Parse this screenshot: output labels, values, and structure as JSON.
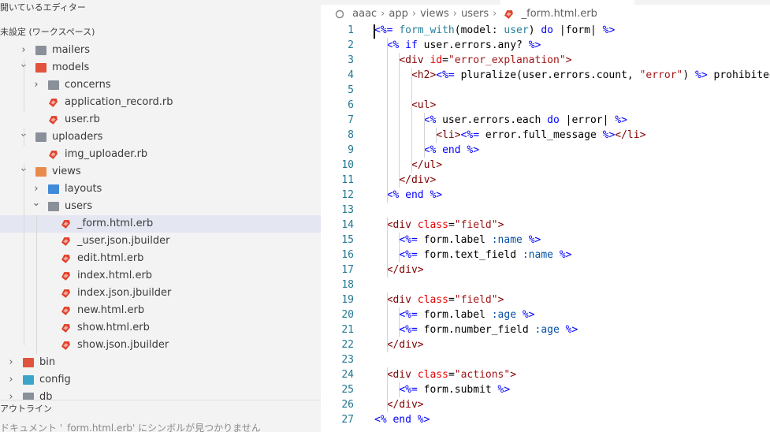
{
  "sidebar": {
    "open_editors_header": "開いているエディター",
    "workspace_header": "未設定 (ワークスペース)",
    "tree": [
      {
        "label": "mailers",
        "kind": "folder",
        "expanded": false,
        "depth": 1
      },
      {
        "label": "models",
        "kind": "folder-red",
        "expanded": true,
        "depth": 1
      },
      {
        "label": "concerns",
        "kind": "folder",
        "expanded": false,
        "depth": 2
      },
      {
        "label": "application_record.rb",
        "kind": "ruby",
        "depth": 2
      },
      {
        "label": "user.rb",
        "kind": "ruby",
        "depth": 2
      },
      {
        "label": "uploaders",
        "kind": "folder",
        "expanded": true,
        "depth": 1
      },
      {
        "label": "img_uploader.rb",
        "kind": "ruby",
        "depth": 2
      },
      {
        "label": "views",
        "kind": "folder-orange",
        "expanded": true,
        "depth": 1
      },
      {
        "label": "layouts",
        "kind": "folder-blue",
        "expanded": false,
        "depth": 2
      },
      {
        "label": "users",
        "kind": "folder",
        "expanded": true,
        "depth": 2
      },
      {
        "label": "_form.html.erb",
        "kind": "ruby",
        "depth": 3,
        "selected": true
      },
      {
        "label": "_user.json.jbuilder",
        "kind": "ruby",
        "depth": 3
      },
      {
        "label": "edit.html.erb",
        "kind": "ruby",
        "depth": 3
      },
      {
        "label": "index.html.erb",
        "kind": "ruby",
        "depth": 3
      },
      {
        "label": "index.json.jbuilder",
        "kind": "ruby",
        "depth": 3
      },
      {
        "label": "new.html.erb",
        "kind": "ruby",
        "depth": 3
      },
      {
        "label": "show.html.erb",
        "kind": "ruby",
        "depth": 3
      },
      {
        "label": "show.json.jbuilder",
        "kind": "ruby",
        "depth": 3
      },
      {
        "label": "bin",
        "kind": "folder-red",
        "expanded": false,
        "depth": 0
      },
      {
        "label": "config",
        "kind": "folder-cyan",
        "expanded": false,
        "depth": 0
      },
      {
        "label": "db",
        "kind": "folder",
        "expanded": false,
        "depth": 0
      }
    ],
    "outline_header": "アウトライン",
    "outline_message": "ドキュメント '_form.html.erb' にシンボルが見つかりません"
  },
  "editor": {
    "breadcrumb": [
      "aaac",
      "app",
      "views",
      "users",
      "_form.html.erb"
    ],
    "lines": [
      {
        "n": "1",
        "tokens": [
          [
            "erb",
            "<%="
          ],
          [
            "txt",
            " "
          ],
          [
            "rb",
            "form_with"
          ],
          [
            "txt",
            "(model: "
          ],
          [
            "rb",
            "user"
          ],
          [
            "txt",
            ") "
          ],
          [
            "kw",
            "do"
          ],
          [
            "txt",
            " |form| "
          ],
          [
            "erb",
            "%>"
          ]
        ]
      },
      {
        "n": "2",
        "tokens": [
          [
            "txt",
            "  "
          ],
          [
            "erb",
            "<%"
          ],
          [
            "txt",
            " "
          ],
          [
            "kw",
            "if"
          ],
          [
            "txt",
            " user.errors.any? "
          ],
          [
            "erb",
            "%>"
          ]
        ]
      },
      {
        "n": "3",
        "tokens": [
          [
            "txt",
            "    "
          ],
          [
            "tag",
            "<div"
          ],
          [
            "txt",
            " "
          ],
          [
            "attr",
            "id"
          ],
          [
            "txt",
            "="
          ],
          [
            "str",
            "\"error_explanation\""
          ],
          [
            "tag",
            ">"
          ]
        ]
      },
      {
        "n": "4",
        "tokens": [
          [
            "txt",
            "      "
          ],
          [
            "tag",
            "<h2>"
          ],
          [
            "erb",
            "<%="
          ],
          [
            "txt",
            " pluralize(user.errors.count, "
          ],
          [
            "str",
            "\"error\""
          ],
          [
            "txt",
            ") "
          ],
          [
            "erb",
            "%>"
          ],
          [
            "txt",
            " prohibited"
          ]
        ]
      },
      {
        "n": "5",
        "tokens": []
      },
      {
        "n": "6",
        "tokens": [
          [
            "txt",
            "      "
          ],
          [
            "tag",
            "<ul>"
          ]
        ]
      },
      {
        "n": "7",
        "tokens": [
          [
            "txt",
            "        "
          ],
          [
            "erb",
            "<%"
          ],
          [
            "txt",
            " user.errors.each "
          ],
          [
            "kw",
            "do"
          ],
          [
            "txt",
            " |error| "
          ],
          [
            "erb",
            "%>"
          ]
        ]
      },
      {
        "n": "8",
        "tokens": [
          [
            "txt",
            "          "
          ],
          [
            "tag",
            "<li>"
          ],
          [
            "erb",
            "<%="
          ],
          [
            "txt",
            " error.full_message "
          ],
          [
            "erb",
            "%>"
          ],
          [
            "tag",
            "</li>"
          ]
        ]
      },
      {
        "n": "9",
        "tokens": [
          [
            "txt",
            "        "
          ],
          [
            "erb",
            "<%"
          ],
          [
            "txt",
            " "
          ],
          [
            "kw",
            "end"
          ],
          [
            "txt",
            " "
          ],
          [
            "erb",
            "%>"
          ]
        ]
      },
      {
        "n": "10",
        "tokens": [
          [
            "txt",
            "      "
          ],
          [
            "tag",
            "</ul>"
          ]
        ]
      },
      {
        "n": "11",
        "tokens": [
          [
            "txt",
            "    "
          ],
          [
            "tag",
            "</div>"
          ]
        ]
      },
      {
        "n": "12",
        "tokens": [
          [
            "txt",
            "  "
          ],
          [
            "erb",
            "<%"
          ],
          [
            "txt",
            " "
          ],
          [
            "kw",
            "end"
          ],
          [
            "txt",
            " "
          ],
          [
            "erb",
            "%>"
          ]
        ]
      },
      {
        "n": "13",
        "tokens": []
      },
      {
        "n": "14",
        "tokens": [
          [
            "txt",
            "  "
          ],
          [
            "tag",
            "<div"
          ],
          [
            "txt",
            " "
          ],
          [
            "attr",
            "class"
          ],
          [
            "txt",
            "="
          ],
          [
            "str",
            "\"field\""
          ],
          [
            "tag",
            ">"
          ]
        ]
      },
      {
        "n": "15",
        "tokens": [
          [
            "txt",
            "    "
          ],
          [
            "erb",
            "<%="
          ],
          [
            "txt",
            " form.label "
          ],
          [
            "sym",
            ":name"
          ],
          [
            "txt",
            " "
          ],
          [
            "erb",
            "%>"
          ]
        ]
      },
      {
        "n": "16",
        "tokens": [
          [
            "txt",
            "    "
          ],
          [
            "erb",
            "<%="
          ],
          [
            "txt",
            " form.text_field "
          ],
          [
            "sym",
            ":name"
          ],
          [
            "txt",
            " "
          ],
          [
            "erb",
            "%>"
          ]
        ]
      },
      {
        "n": "17",
        "tokens": [
          [
            "txt",
            "  "
          ],
          [
            "tag",
            "</div>"
          ]
        ]
      },
      {
        "n": "18",
        "tokens": []
      },
      {
        "n": "19",
        "tokens": [
          [
            "txt",
            "  "
          ],
          [
            "tag",
            "<div"
          ],
          [
            "txt",
            " "
          ],
          [
            "attr",
            "class"
          ],
          [
            "txt",
            "="
          ],
          [
            "str",
            "\"field\""
          ],
          [
            "tag",
            ">"
          ]
        ]
      },
      {
        "n": "20",
        "tokens": [
          [
            "txt",
            "    "
          ],
          [
            "erb",
            "<%="
          ],
          [
            "txt",
            " form.label "
          ],
          [
            "sym",
            ":age"
          ],
          [
            "txt",
            " "
          ],
          [
            "erb",
            "%>"
          ]
        ]
      },
      {
        "n": "21",
        "tokens": [
          [
            "txt",
            "    "
          ],
          [
            "erb",
            "<%="
          ],
          [
            "txt",
            " form.number_field "
          ],
          [
            "sym",
            ":age"
          ],
          [
            "txt",
            " "
          ],
          [
            "erb",
            "%>"
          ]
        ]
      },
      {
        "n": "22",
        "tokens": [
          [
            "txt",
            "  "
          ],
          [
            "tag",
            "</div>"
          ]
        ]
      },
      {
        "n": "23",
        "tokens": []
      },
      {
        "n": "24",
        "tokens": [
          [
            "txt",
            "  "
          ],
          [
            "tag",
            "<div"
          ],
          [
            "txt",
            " "
          ],
          [
            "attr",
            "class"
          ],
          [
            "txt",
            "="
          ],
          [
            "str",
            "\"actions\""
          ],
          [
            "tag",
            ">"
          ]
        ]
      },
      {
        "n": "25",
        "tokens": [
          [
            "txt",
            "    "
          ],
          [
            "erb",
            "<%="
          ],
          [
            "txt",
            " form.submit "
          ],
          [
            "erb",
            "%>"
          ]
        ]
      },
      {
        "n": "26",
        "tokens": [
          [
            "txt",
            "  "
          ],
          [
            "tag",
            "</div>"
          ]
        ]
      },
      {
        "n": "27",
        "tokens": [
          [
            "erb",
            "<%"
          ],
          [
            "txt",
            " "
          ],
          [
            "kw",
            "end"
          ],
          [
            "txt",
            " "
          ],
          [
            "erb",
            "%>"
          ]
        ]
      }
    ]
  }
}
